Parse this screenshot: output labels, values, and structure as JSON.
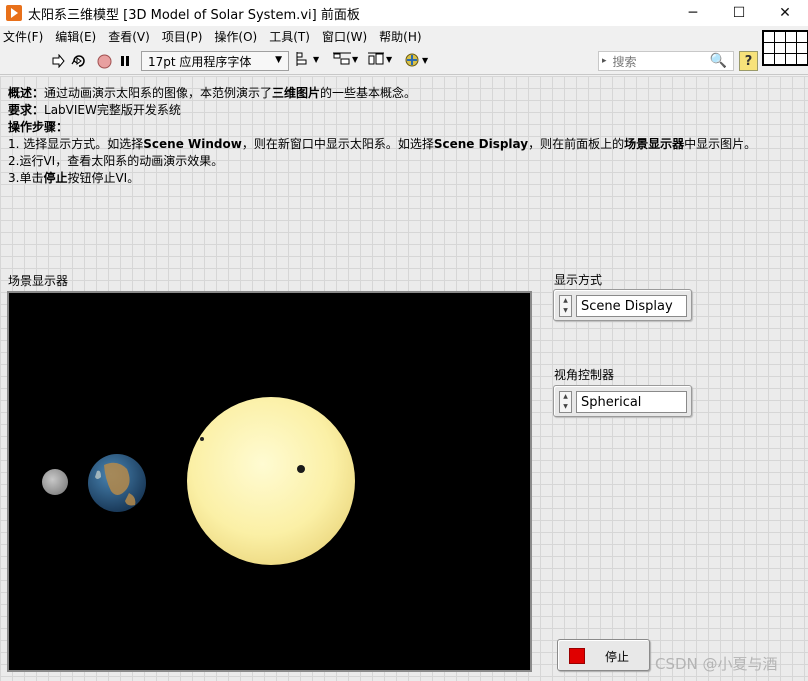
{
  "window": {
    "title": "太阳系三维模型 [3D Model of Solar System.vi] 前面板",
    "minimize": "─",
    "maximize": "☐",
    "close": "✕"
  },
  "menu": [
    "文件(F)",
    "编辑(E)",
    "查看(V)",
    "项目(P)",
    "操作(O)",
    "工具(T)",
    "窗口(W)",
    "帮助(H)"
  ],
  "toolbar": {
    "font": "17pt 应用程序字体",
    "search_placeholder": "搜索",
    "help": "?"
  },
  "description": {
    "overview_label": "概述：",
    "overview_a": "通过动画演示太阳系的图像，本范例演示了",
    "overview_b": "三维图片",
    "overview_c": "的一些基本概念。",
    "req_label": "要求：",
    "req_text": "LabVIEW完整版开发系统",
    "steps_label": "操作步骤：",
    "step1_a": "1.  选择显示方式。如选择",
    "step1_b": "Scene Window",
    "step1_c": "，则在新窗口中显示太阳系。如选择",
    "step1_d": "Scene Display",
    "step1_e": "，则在前面板上的",
    "step1_f": "场景显示器",
    "step1_g": "中显示图片。",
    "step2": "2.运行VI，查看太阳系的动画演示效果。",
    "step3_a": "3.单击",
    "step3_b": "停止",
    "step3_c": "按钮停止VI。"
  },
  "scene_label": "场景显示器",
  "display_mode": {
    "label": "显示方式",
    "value": "Scene Display"
  },
  "camera": {
    "label": "视角控制器",
    "value": "Spherical"
  },
  "stop": {
    "label": "停止",
    "led_color": "#e00000"
  },
  "watermark": "CSDN @小夏与酒"
}
